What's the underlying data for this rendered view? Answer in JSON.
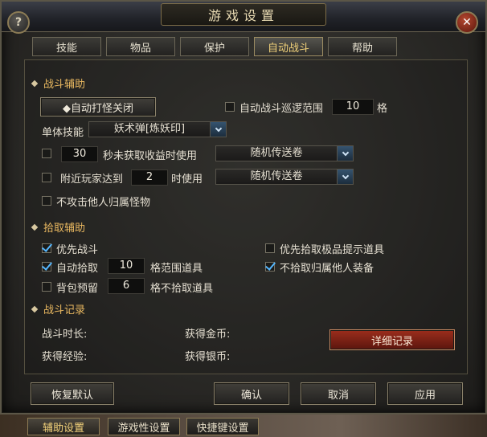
{
  "window": {
    "title": "游戏设置"
  },
  "tabs": [
    "技能",
    "物品",
    "保护",
    "自动战斗",
    "帮助"
  ],
  "combat": {
    "title": "战斗辅助",
    "auto_fight_btn": "◆自动打怪关闭",
    "patrol_label": "自动战斗巡逻范围",
    "patrol_value": "10",
    "patrol_unit": "格",
    "single_skill_label": "单体技能",
    "single_skill_value": "妖术弹[炼妖印]",
    "idle_value": "30",
    "idle_label": "秒未获取收益时使用",
    "idle_item": "随机传送卷",
    "players_label": "附近玩家达到",
    "players_value": "2",
    "players_suffix": "时使用",
    "players_item": "随机传送卷",
    "no_attack_label": "不攻击他人归属怪物"
  },
  "pickup": {
    "title": "拾取辅助",
    "priority_combat": "优先战斗",
    "priority_rare": "优先拾取极品提示道具",
    "auto_pick_label": "自动拾取",
    "auto_pick_value": "10",
    "auto_pick_suffix": "格范围道具",
    "no_others_gear": "不拾取归属他人装备",
    "reserve_label": "背包预留",
    "reserve_value": "6",
    "reserve_suffix": "格不拾取道具"
  },
  "record": {
    "title": "战斗记录",
    "duration_label": "战斗时长:",
    "gold_label": "获得金币:",
    "exp_label": "获得经验:",
    "silver_label": "获得银币:",
    "detail_btn": "详细记录"
  },
  "buttons": {
    "reset": "恢复默认",
    "ok": "确认",
    "cancel": "取消",
    "apply": "应用"
  },
  "footer_tabs": [
    "辅助设置",
    "游戏性设置",
    "快捷键设置"
  ],
  "states": {
    "patrol_checked": false,
    "idle_checked": false,
    "players_checked": false,
    "no_attack_checked": false,
    "priority_combat_checked": true,
    "priority_rare_checked": false,
    "auto_pick_checked": true,
    "no_others_gear_checked": true,
    "reserve_checked": false
  },
  "colors": {
    "accent": "#e9b860",
    "check": "#55b7ff",
    "danger": "#9c2d1c"
  }
}
